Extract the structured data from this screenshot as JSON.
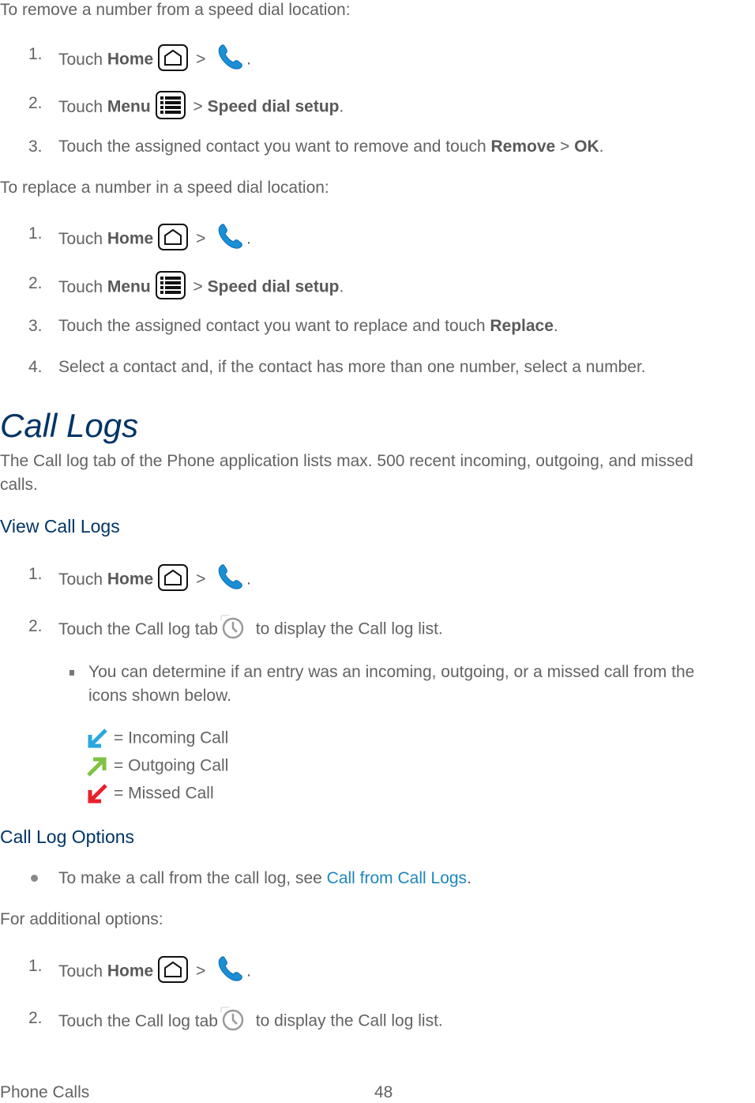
{
  "remove_section": {
    "intro": "To remove a number from a speed dial location:",
    "steps": [
      {
        "num": "1.",
        "pre": "Touch ",
        "bold1": "Home",
        "sep": " > ",
        "post": "."
      },
      {
        "num": "2.",
        "pre": "Touch ",
        "bold1": "Menu",
        "sep": " > ",
        "bold2": "Speed dial setup",
        "post": "."
      },
      {
        "num": "3.",
        "pre": "Touch the assigned contact you want to remove and touch ",
        "bold1": "Remove",
        "sep": " > ",
        "bold2": "OK",
        "post": "."
      }
    ]
  },
  "replace_section": {
    "intro": "To replace a number in a speed dial location:",
    "steps": [
      {
        "num": "1.",
        "pre": "Touch ",
        "bold1": "Home",
        "sep": " > ",
        "post": "."
      },
      {
        "num": "2.",
        "pre": "Touch ",
        "bold1": "Menu",
        "sep": " > ",
        "bold2": "Speed dial setup",
        "post": "."
      },
      {
        "num": "3.",
        "pre": "Touch the assigned contact you want to replace and touch ",
        "bold1": "Replace",
        "post": "."
      },
      {
        "num": "4.",
        "text": "Select a contact and, if the contact has more than one number, select a number."
      }
    ]
  },
  "call_logs": {
    "title": "Call Logs",
    "desc_line1": "The Call log tab of the Phone application lists max. 500 recent incoming, outgoing, and missed",
    "desc_line2": "calls.",
    "view": {
      "heading": "View Call Logs",
      "steps": [
        {
          "num": "1.",
          "pre": "Touch ",
          "bold1": "Home",
          "sep": " > ",
          "post": "."
        },
        {
          "num": "2.",
          "pre": "Touch the Call log tab",
          "post": " to display the Call log list."
        }
      ],
      "bullet_line1": "You can determine if an entry was an incoming, outgoing, or a missed call from the",
      "bullet_line2": "icons shown below.",
      "legend": [
        {
          "icon": "incoming-call-arrow",
          "color": "#29a8e0",
          "label": "= Incoming Call"
        },
        {
          "icon": "outgoing-call-arrow",
          "color": "#7dc242",
          "label": "= Outgoing Call"
        },
        {
          "icon": "missed-call-arrow",
          "color": "#e8202a",
          "label": "= Missed Call"
        }
      ]
    },
    "options": {
      "heading": "Call Log Options",
      "bullet_pre": "To make a call from the call log, see ",
      "bullet_link": "Call from Call Logs",
      "bullet_post": ".",
      "intro": "For additional options:",
      "steps": [
        {
          "num": "1.",
          "pre": "Touch ",
          "bold1": "Home",
          "sep": " > ",
          "post": "."
        },
        {
          "num": "2.",
          "pre": "Touch the Call log tab",
          "post": " to display the Call log list."
        }
      ]
    }
  },
  "footer": {
    "section": "Phone Calls",
    "page": "48"
  },
  "colors": {
    "heading": "#003466",
    "link": "#1e86bd",
    "body_text": "#636363"
  }
}
